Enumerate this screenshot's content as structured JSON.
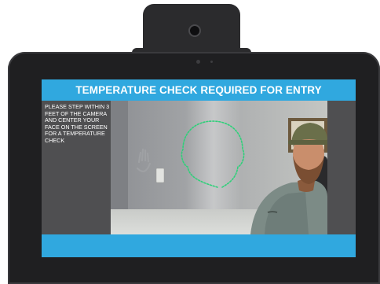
{
  "screen": {
    "title": "TEMPERATURE CHECK REQUIRED FOR ENTRY",
    "instructions": "PLEASE STEP WITHIN 3 FEET OF THE CAMERA AND CENTER YOUR FACE ON THE SCREEN FOR A TEMPERATURE CHECK",
    "accent_color": "#30a8df",
    "face_guide_color": "#2fd07a"
  },
  "icons": {
    "camera": "camera-lens-icon",
    "face_guide": "face-outline-guide-icon"
  }
}
